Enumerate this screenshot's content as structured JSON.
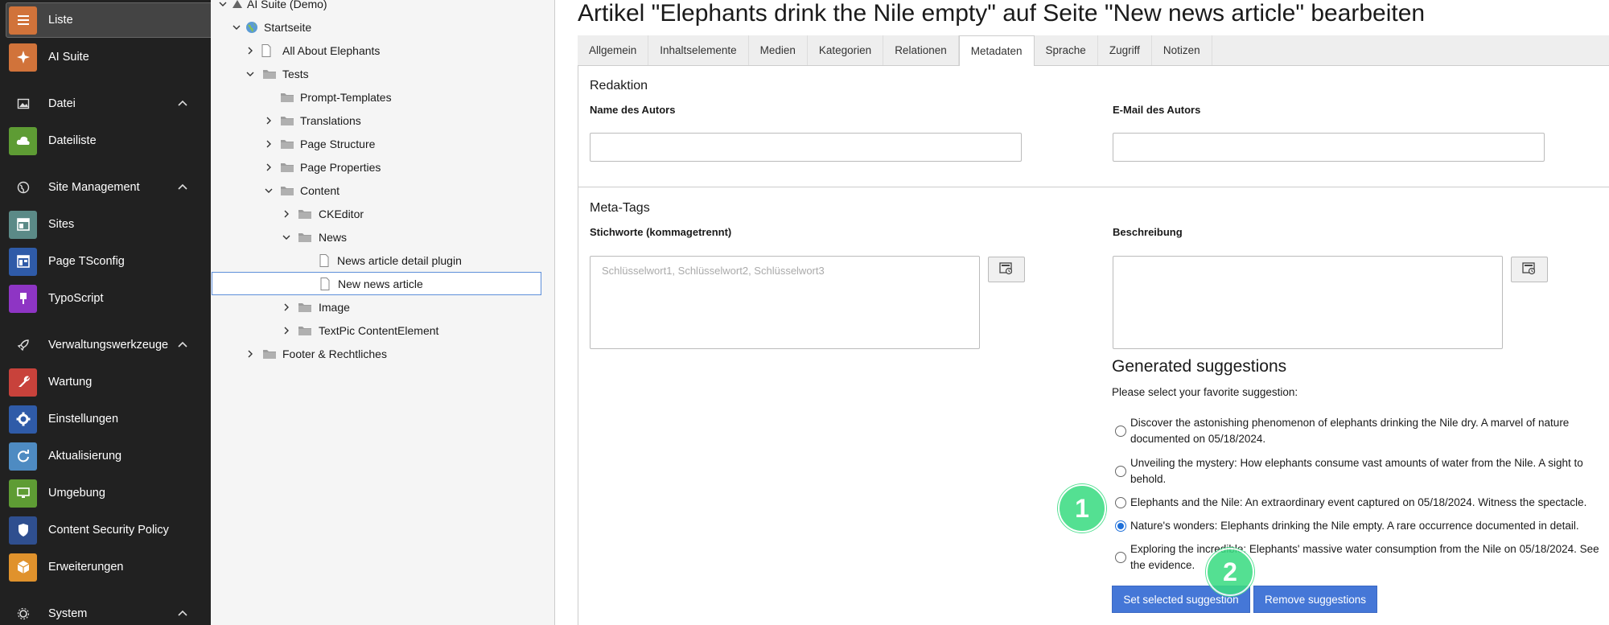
{
  "module_menu": {
    "items": [
      {
        "id": "liste",
        "label": "Liste",
        "icon": "list-icon",
        "color": "#d1733a",
        "active": true
      },
      {
        "id": "ai-suite",
        "label": "AI Suite",
        "icon": "sparkle-icon",
        "color": "#d1733a"
      },
      {
        "id": "datei-group",
        "label": "Datei",
        "icon": "image-icon",
        "group": true
      },
      {
        "id": "dateiliste",
        "label": "Dateiliste",
        "icon": "cloud-icon",
        "color": "#5e9c34"
      },
      {
        "id": "site-group",
        "label": "Site Management",
        "icon": "globe-icon",
        "group": true
      },
      {
        "id": "sites",
        "label": "Sites",
        "icon": "sites-icon",
        "color": "#5b8a87"
      },
      {
        "id": "page-tsconfig",
        "label": "Page TSconfig",
        "icon": "layout-icon",
        "color": "#2f5ba8"
      },
      {
        "id": "typoscript",
        "label": "TypoScript",
        "icon": "brush-icon",
        "color": "#8e35c4"
      },
      {
        "id": "verw-group",
        "label": "Verwaltungswerkzeuge",
        "icon": "rocket-icon",
        "group": true
      },
      {
        "id": "wartung",
        "label": "Wartung",
        "icon": "wrench-icon",
        "color": "#c8423b"
      },
      {
        "id": "einstellungen",
        "label": "Einstellungen",
        "icon": "gear-icon",
        "color": "#2f5ba8"
      },
      {
        "id": "aktualisierung",
        "label": "Aktualisierung",
        "icon": "refresh-icon",
        "color": "#4e8bc2"
      },
      {
        "id": "umgebung",
        "label": "Umgebung",
        "icon": "monitor-icon",
        "color": "#5e9c34"
      },
      {
        "id": "csp",
        "label": "Content Security Policy",
        "icon": "shield-icon",
        "color": "#2f4f8f"
      },
      {
        "id": "erweiterungen",
        "label": "Erweiterungen",
        "icon": "box-icon",
        "color": "#e0922c"
      },
      {
        "id": "system-group",
        "label": "System",
        "icon": "gear-icon",
        "group": true
      }
    ]
  },
  "page_tree": {
    "nodes": [
      {
        "label": "AI Suite (Demo)",
        "icon": "root-icon"
      },
      {
        "label": "Startseite",
        "icon": "globe-page-icon"
      },
      {
        "label": "All About Elephants",
        "icon": "page-icon"
      },
      {
        "label": "Tests",
        "icon": "folder-icon"
      },
      {
        "label": "Prompt-Templates",
        "icon": "folder-icon"
      },
      {
        "label": "Translations",
        "icon": "folder-icon"
      },
      {
        "label": "Page Structure",
        "icon": "folder-icon"
      },
      {
        "label": "Page Properties",
        "icon": "folder-icon"
      },
      {
        "label": "Content",
        "icon": "folder-icon"
      },
      {
        "label": "CKEditor",
        "icon": "folder-icon"
      },
      {
        "label": "News",
        "icon": "folder-icon"
      },
      {
        "label": "News article detail plugin",
        "icon": "page-icon"
      },
      {
        "label": "New news article",
        "icon": "page-icon",
        "selected": true
      },
      {
        "label": "Image",
        "icon": "folder-icon"
      },
      {
        "label": "TextPic ContentElement",
        "icon": "folder-icon"
      },
      {
        "label": "Footer & Rechtliches",
        "icon": "folder-icon"
      }
    ]
  },
  "editor": {
    "title": "Artikel \"Elephants drink the Nile empty\" auf Seite \"New news article\" bearbeiten",
    "tabs": [
      "Allgemein",
      "Inhaltselemente",
      "Medien",
      "Kategorien",
      "Relationen",
      "Metadaten",
      "Sprache",
      "Zugriff",
      "Notizen"
    ],
    "active_tab": "Metadaten",
    "redaktion": {
      "title": "Redaktion",
      "author_label": "Name des Autors",
      "author_value": "",
      "email_label": "E-Mail des Autors",
      "email_value": ""
    },
    "meta_tags": {
      "title": "Meta-Tags",
      "keywords_label": "Stichworte (kommagetrennt)",
      "keywords_placeholder": "Schlüsselwort1, Schlüsselwort2, Schlüsselwort3",
      "description_label": "Beschreibung",
      "description_value": ""
    },
    "suggestions": {
      "title": "Generated suggestions",
      "subtitle": "Please select your favorite suggestion:",
      "items": [
        {
          "text": "Discover the astonishing phenomenon of elephants drinking the Nile dry. A marvel of nature documented on 05/18/2024.",
          "checked": false
        },
        {
          "text": "Unveiling the mystery: How elephants consume vast amounts of water from the Nile. A sight to behold.",
          "checked": false
        },
        {
          "text": "Elephants and the Nile: An extraordinary event captured on 05/18/2024. Witness the spectacle.",
          "checked": false
        },
        {
          "text": "Nature's wonders: Elephants drinking the Nile empty. A rare occurrence documented in detail.",
          "checked": true
        },
        {
          "text": "Exploring the incredible: Elephants' massive water consumption from the Nile on 05/18/2024. See the evidence.",
          "checked": false
        }
      ],
      "set_button": "Set selected suggestion",
      "remove_button": "Remove suggestions"
    },
    "markers": [
      "1",
      "2"
    ]
  }
}
